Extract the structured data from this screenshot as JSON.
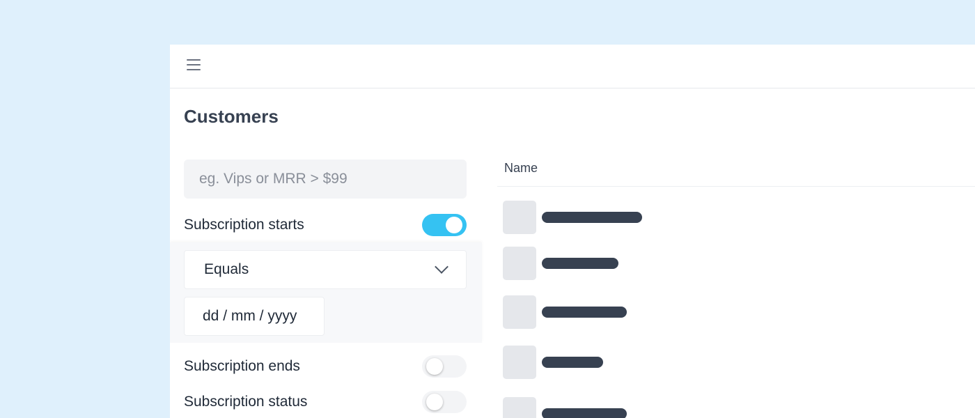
{
  "page": {
    "title": "Customers"
  },
  "filters": {
    "search": {
      "placeholder": "eg. Vips or MRR > $99",
      "value": ""
    },
    "items": [
      {
        "label": "Subscription starts",
        "enabled": true
      },
      {
        "label": "Subscription ends",
        "enabled": false
      },
      {
        "label": "Subscription status",
        "enabled": false
      }
    ],
    "condition": {
      "selected": "Equals"
    },
    "date": {
      "placeholder": "dd / mm / yyyy"
    }
  },
  "table": {
    "columns": [
      "Name"
    ]
  },
  "colors": {
    "background": "#dff0fc",
    "accent": "#35c2f2",
    "text": "#374151"
  },
  "icons": {
    "menu": "hamburger-menu-icon",
    "dropdown": "chevron-down-icon"
  }
}
